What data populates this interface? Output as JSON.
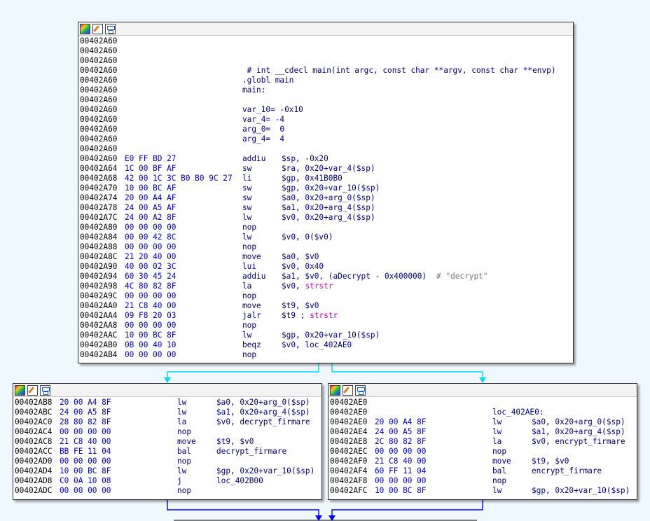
{
  "colors": {
    "edge_true": "#00c8ff",
    "edge_flow": "#0000ff",
    "background": "#f0f8ff"
  },
  "toolbar_icons": [
    "color-palette-icon",
    "rename-pencil-icon",
    "graph-overview-icon"
  ],
  "main_block": {
    "header": [
      "00402A60",
      "00402A60",
      "00402A60",
      "00402A60",
      "00402A60",
      "00402A60",
      "00402A60",
      "00402A60",
      "00402A60",
      "00402A60",
      "00402A60",
      "00402A60"
    ],
    "header_text": [
      "",
      "",
      "",
      " # int __cdecl main(int argc, const char **argv, const char **envp)",
      ".globl main",
      "main:",
      "",
      "var_10= -0x10",
      "var_4= -4",
      "arg_0=  0",
      "arg_4=  4",
      ""
    ],
    "instructions": [
      {
        "addr": "00402A60",
        "bytes": "E0 FF BD 27",
        "mn": "addiu",
        "op": "$sp, -0x20",
        "ext": "",
        "cm": ""
      },
      {
        "addr": "00402A64",
        "bytes": "1C 00 BF AF",
        "mn": "sw",
        "op": "$ra, 0x20+var_4($sp)",
        "ext": "",
        "cm": ""
      },
      {
        "addr": "00402A68",
        "bytes": "42 00 1C 3C B0 B0 9C 27",
        "mn": "li",
        "op": "$gp, 0x41B0B0",
        "ext": "",
        "cm": ""
      },
      {
        "addr": "00402A70",
        "bytes": "10 00 BC AF",
        "mn": "sw",
        "op": "$gp, 0x20+var_10($sp)",
        "ext": "",
        "cm": ""
      },
      {
        "addr": "00402A74",
        "bytes": "20 00 A4 AF",
        "mn": "sw",
        "op": "$a0, 0x20+arg_0($sp)",
        "ext": "",
        "cm": ""
      },
      {
        "addr": "00402A78",
        "bytes": "24 00 A5 AF",
        "mn": "sw",
        "op": "$a1, 0x20+arg_4($sp)",
        "ext": "",
        "cm": ""
      },
      {
        "addr": "00402A7C",
        "bytes": "24 00 A2 8F",
        "mn": "lw",
        "op": "$v0, 0x20+arg_4($sp)",
        "ext": "",
        "cm": ""
      },
      {
        "addr": "00402A80",
        "bytes": "00 00 00 00",
        "mn": "nop",
        "op": "",
        "ext": "",
        "cm": ""
      },
      {
        "addr": "00402A84",
        "bytes": "00 00 42 8C",
        "mn": "lw",
        "op": "$v0, 0($v0)",
        "ext": "",
        "cm": ""
      },
      {
        "addr": "00402A88",
        "bytes": "00 00 00 00",
        "mn": "nop",
        "op": "",
        "ext": "",
        "cm": ""
      },
      {
        "addr": "00402A8C",
        "bytes": "21 20 40 00",
        "mn": "move",
        "op": "$a0, $v0",
        "ext": "",
        "cm": ""
      },
      {
        "addr": "00402A90",
        "bytes": "40 00 02 3C",
        "mn": "lui",
        "op": "$v0, 0x40",
        "ext": "",
        "cm": ""
      },
      {
        "addr": "00402A94",
        "bytes": "60 30 45 24",
        "mn": "addiu",
        "op": "$a1, $v0, (aDecrypt - 0x400000)",
        "ext": "",
        "cm": "  # \"decrypt\""
      },
      {
        "addr": "00402A98",
        "bytes": "4C 80 82 8F",
        "mn": "la",
        "op": "$v0, ",
        "ext": "strstr",
        "cm": ""
      },
      {
        "addr": "00402A9C",
        "bytes": "00 00 00 00",
        "mn": "nop",
        "op": "",
        "ext": "",
        "cm": ""
      },
      {
        "addr": "00402AA0",
        "bytes": "21 C8 40 00",
        "mn": "move",
        "op": "$t9, $v0",
        "ext": "",
        "cm": ""
      },
      {
        "addr": "00402AA4",
        "bytes": "09 F8 20 03",
        "mn": "jalr",
        "op": "$t9 ; ",
        "ext": "strstr",
        "cm": ""
      },
      {
        "addr": "00402AA8",
        "bytes": "00 00 00 00",
        "mn": "nop",
        "op": "",
        "ext": "",
        "cm": ""
      },
      {
        "addr": "00402AAC",
        "bytes": "10 00 BC 8F",
        "mn": "lw",
        "op": "$gp, 0x20+var_10($sp)",
        "ext": "",
        "cm": ""
      },
      {
        "addr": "00402AB0",
        "bytes": "0B 00 40 10",
        "mn": "beqz",
        "op": "$v0, loc_402AE0",
        "ext": "",
        "cm": ""
      },
      {
        "addr": "00402AB4",
        "bytes": "00 00 00 00",
        "mn": "nop",
        "op": "",
        "ext": "",
        "cm": ""
      }
    ]
  },
  "left_block": {
    "instructions": [
      {
        "addr": "00402AB8",
        "bytes": "20 00 A4 8F",
        "mn": "lw",
        "op": "$a0, 0x20+arg_0($sp)"
      },
      {
        "addr": "00402ABC",
        "bytes": "24 00 A5 8F",
        "mn": "lw",
        "op": "$a1, 0x20+arg_4($sp)"
      },
      {
        "addr": "00402AC0",
        "bytes": "28 80 82 8F",
        "mn": "la",
        "op": "$v0, decrypt_firmare"
      },
      {
        "addr": "00402AC4",
        "bytes": "00 00 00 00",
        "mn": "nop",
        "op": ""
      },
      {
        "addr": "00402AC8",
        "bytes": "21 C8 40 00",
        "mn": "move",
        "op": "$t9, $v0"
      },
      {
        "addr": "00402ACC",
        "bytes": "BB FE 11 04",
        "mn": "bal",
        "op": "decrypt_firmare"
      },
      {
        "addr": "00402AD0",
        "bytes": "00 00 00 00",
        "mn": "nop",
        "op": ""
      },
      {
        "addr": "00402AD4",
        "bytes": "10 00 BC 8F",
        "mn": "lw",
        "op": "$gp, 0x20+var_10($sp)"
      },
      {
        "addr": "00402AD8",
        "bytes": "C0 0A 10 08",
        "mn": "j",
        "op": "loc_402B00"
      },
      {
        "addr": "00402ADC",
        "bytes": "00 00 00 00",
        "mn": "nop",
        "op": ""
      }
    ]
  },
  "right_block": {
    "header_addr": [
      "00402AE0",
      "00402AE0"
    ],
    "label": "loc_402AE0:",
    "instructions": [
      {
        "addr": "00402AE0",
        "bytes": "20 00 A4 8F",
        "mn": "lw",
        "op": "$a0, 0x20+arg_0($sp)"
      },
      {
        "addr": "00402AE4",
        "bytes": "24 00 A5 8F",
        "mn": "lw",
        "op": "$a1, 0x20+arg_4($sp)"
      },
      {
        "addr": "00402AE8",
        "bytes": "2C 80 82 8F",
        "mn": "la",
        "op": "$v0, encrypt_firmare"
      },
      {
        "addr": "00402AEC",
        "bytes": "00 00 00 00",
        "mn": "nop",
        "op": ""
      },
      {
        "addr": "00402AF0",
        "bytes": "21 C8 40 00",
        "mn": "move",
        "op": "$t9, $v0"
      },
      {
        "addr": "00402AF4",
        "bytes": "60 FF 11 04",
        "mn": "bal",
        "op": "encrypt_firmare"
      },
      {
        "addr": "00402AF8",
        "bytes": "00 00 00 00",
        "mn": "nop",
        "op": ""
      },
      {
        "addr": "00402AFC",
        "bytes": "10 00 BC 8F",
        "mn": "lw",
        "op": "$gp, 0x20+var_10($sp)"
      }
    ]
  }
}
